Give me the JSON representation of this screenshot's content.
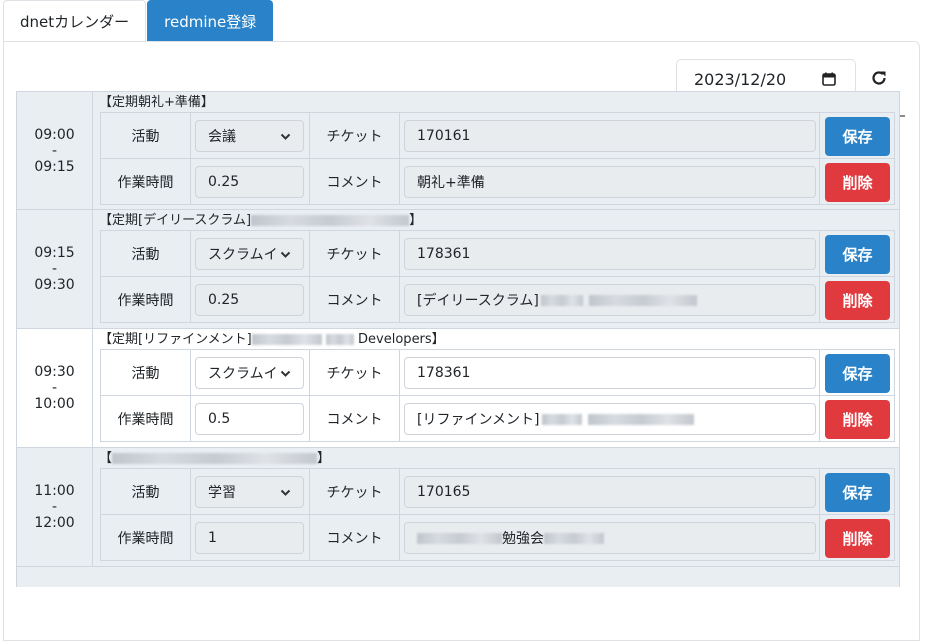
{
  "tabs": [
    {
      "label": "dnetカレンダー",
      "active": false
    },
    {
      "label": "redmine登録",
      "active": true
    }
  ],
  "date": {
    "value": "2023/12/20"
  },
  "labels": {
    "activity": "活動",
    "ticket": "チケット",
    "hours": "作業時間",
    "comment": "コメント",
    "save": "保存",
    "delete": "削除"
  },
  "colors": {
    "primary": "#2a83c8",
    "danger": "#e03a3e",
    "row_shade": "#e9eef3"
  },
  "entries": [
    {
      "start": "09:00",
      "sep": "-",
      "end": "09:15",
      "title_pre": "【定期朝礼+準備】",
      "title_post": "",
      "activity": "会議",
      "ticket": "170161",
      "hours": "0.25",
      "comment": "朝礼+準備",
      "editable": false
    },
    {
      "start": "09:15",
      "sep": "-",
      "end": "09:30",
      "title_pre": "【定期[デイリースクラム]",
      "title_post": "】",
      "activity": "スクラムイ",
      "ticket": "178361",
      "hours": "0.25",
      "comment": "[デイリースクラム]",
      "editable": false
    },
    {
      "start": "09:30",
      "sep": "-",
      "end": "10:00",
      "title_pre": "【定期[リファインメント]",
      "title_post": "Developers】",
      "activity": "スクラムイ",
      "ticket": "178361",
      "hours": "0.5",
      "comment": "[リファインメント]",
      "editable": true
    },
    {
      "start": "11:00",
      "sep": "-",
      "end": "12:00",
      "title_pre": "【",
      "title_post": "】",
      "activity": "学習",
      "ticket": "170165",
      "hours": "1",
      "comment": "勉強会",
      "editable": false
    }
  ],
  "icons": {
    "calendar": "calendar-icon",
    "refresh": "refresh-icon",
    "dropdown": "chevron-down-icon"
  }
}
